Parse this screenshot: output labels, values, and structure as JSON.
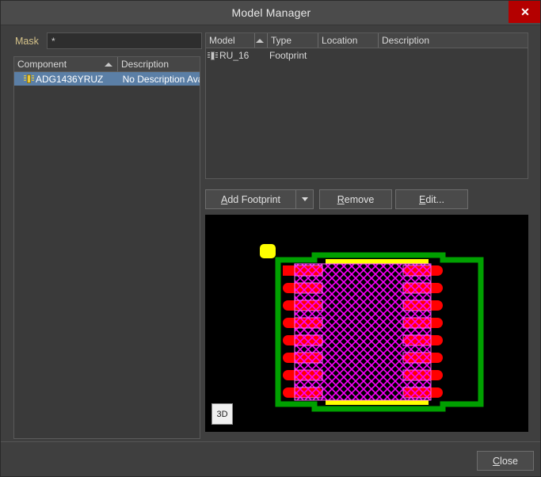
{
  "window": {
    "title": "Model Manager",
    "close_icon": "close-x-icon",
    "close_label": "✕"
  },
  "left_pane": {
    "mask_label": "Mask",
    "mask_value": "*",
    "mask_placeholder": "*",
    "columns": [
      {
        "label": "Component",
        "sorted": "ascending"
      },
      {
        "label": "Description",
        "sorted": "none"
      }
    ],
    "rows": [
      {
        "icon": "ic-chip-icon",
        "component": "ADG1436YRUZ",
        "description": "No Description Availab",
        "selected": true
      }
    ]
  },
  "right_pane": {
    "columns": [
      {
        "label": "Model",
        "sorted": "ascending"
      },
      {
        "label": "Type",
        "sorted": "none"
      },
      {
        "label": "Location",
        "sorted": "none"
      },
      {
        "label": "Description",
        "sorted": "none"
      }
    ],
    "rows": [
      {
        "icon": "ic-chip-icon",
        "model": "RU_16",
        "type": "Footprint",
        "location": "",
        "description": "",
        "selected": false
      }
    ],
    "buttons": {
      "add_footprint": {
        "accel": "A",
        "rest": "dd Footprint"
      },
      "add_footprint_dropdown_icon": "chevron-down-icon",
      "remove": {
        "accel": "R",
        "rest": "emove"
      },
      "edit": {
        "accel": "E",
        "rest": "dit..."
      }
    }
  },
  "preview": {
    "view_3d_label": "3D",
    "colors": {
      "background": "#000000",
      "silkscreen": "#00a000",
      "pad": "#ff0000",
      "courtyard": "#ff00ff",
      "marker": "#ffff00"
    },
    "footprint": {
      "name": "RU_16",
      "pads_per_side": 8,
      "total_pads": 16
    }
  },
  "footer": {
    "close": {
      "accel": "C",
      "rest": "lose"
    }
  }
}
